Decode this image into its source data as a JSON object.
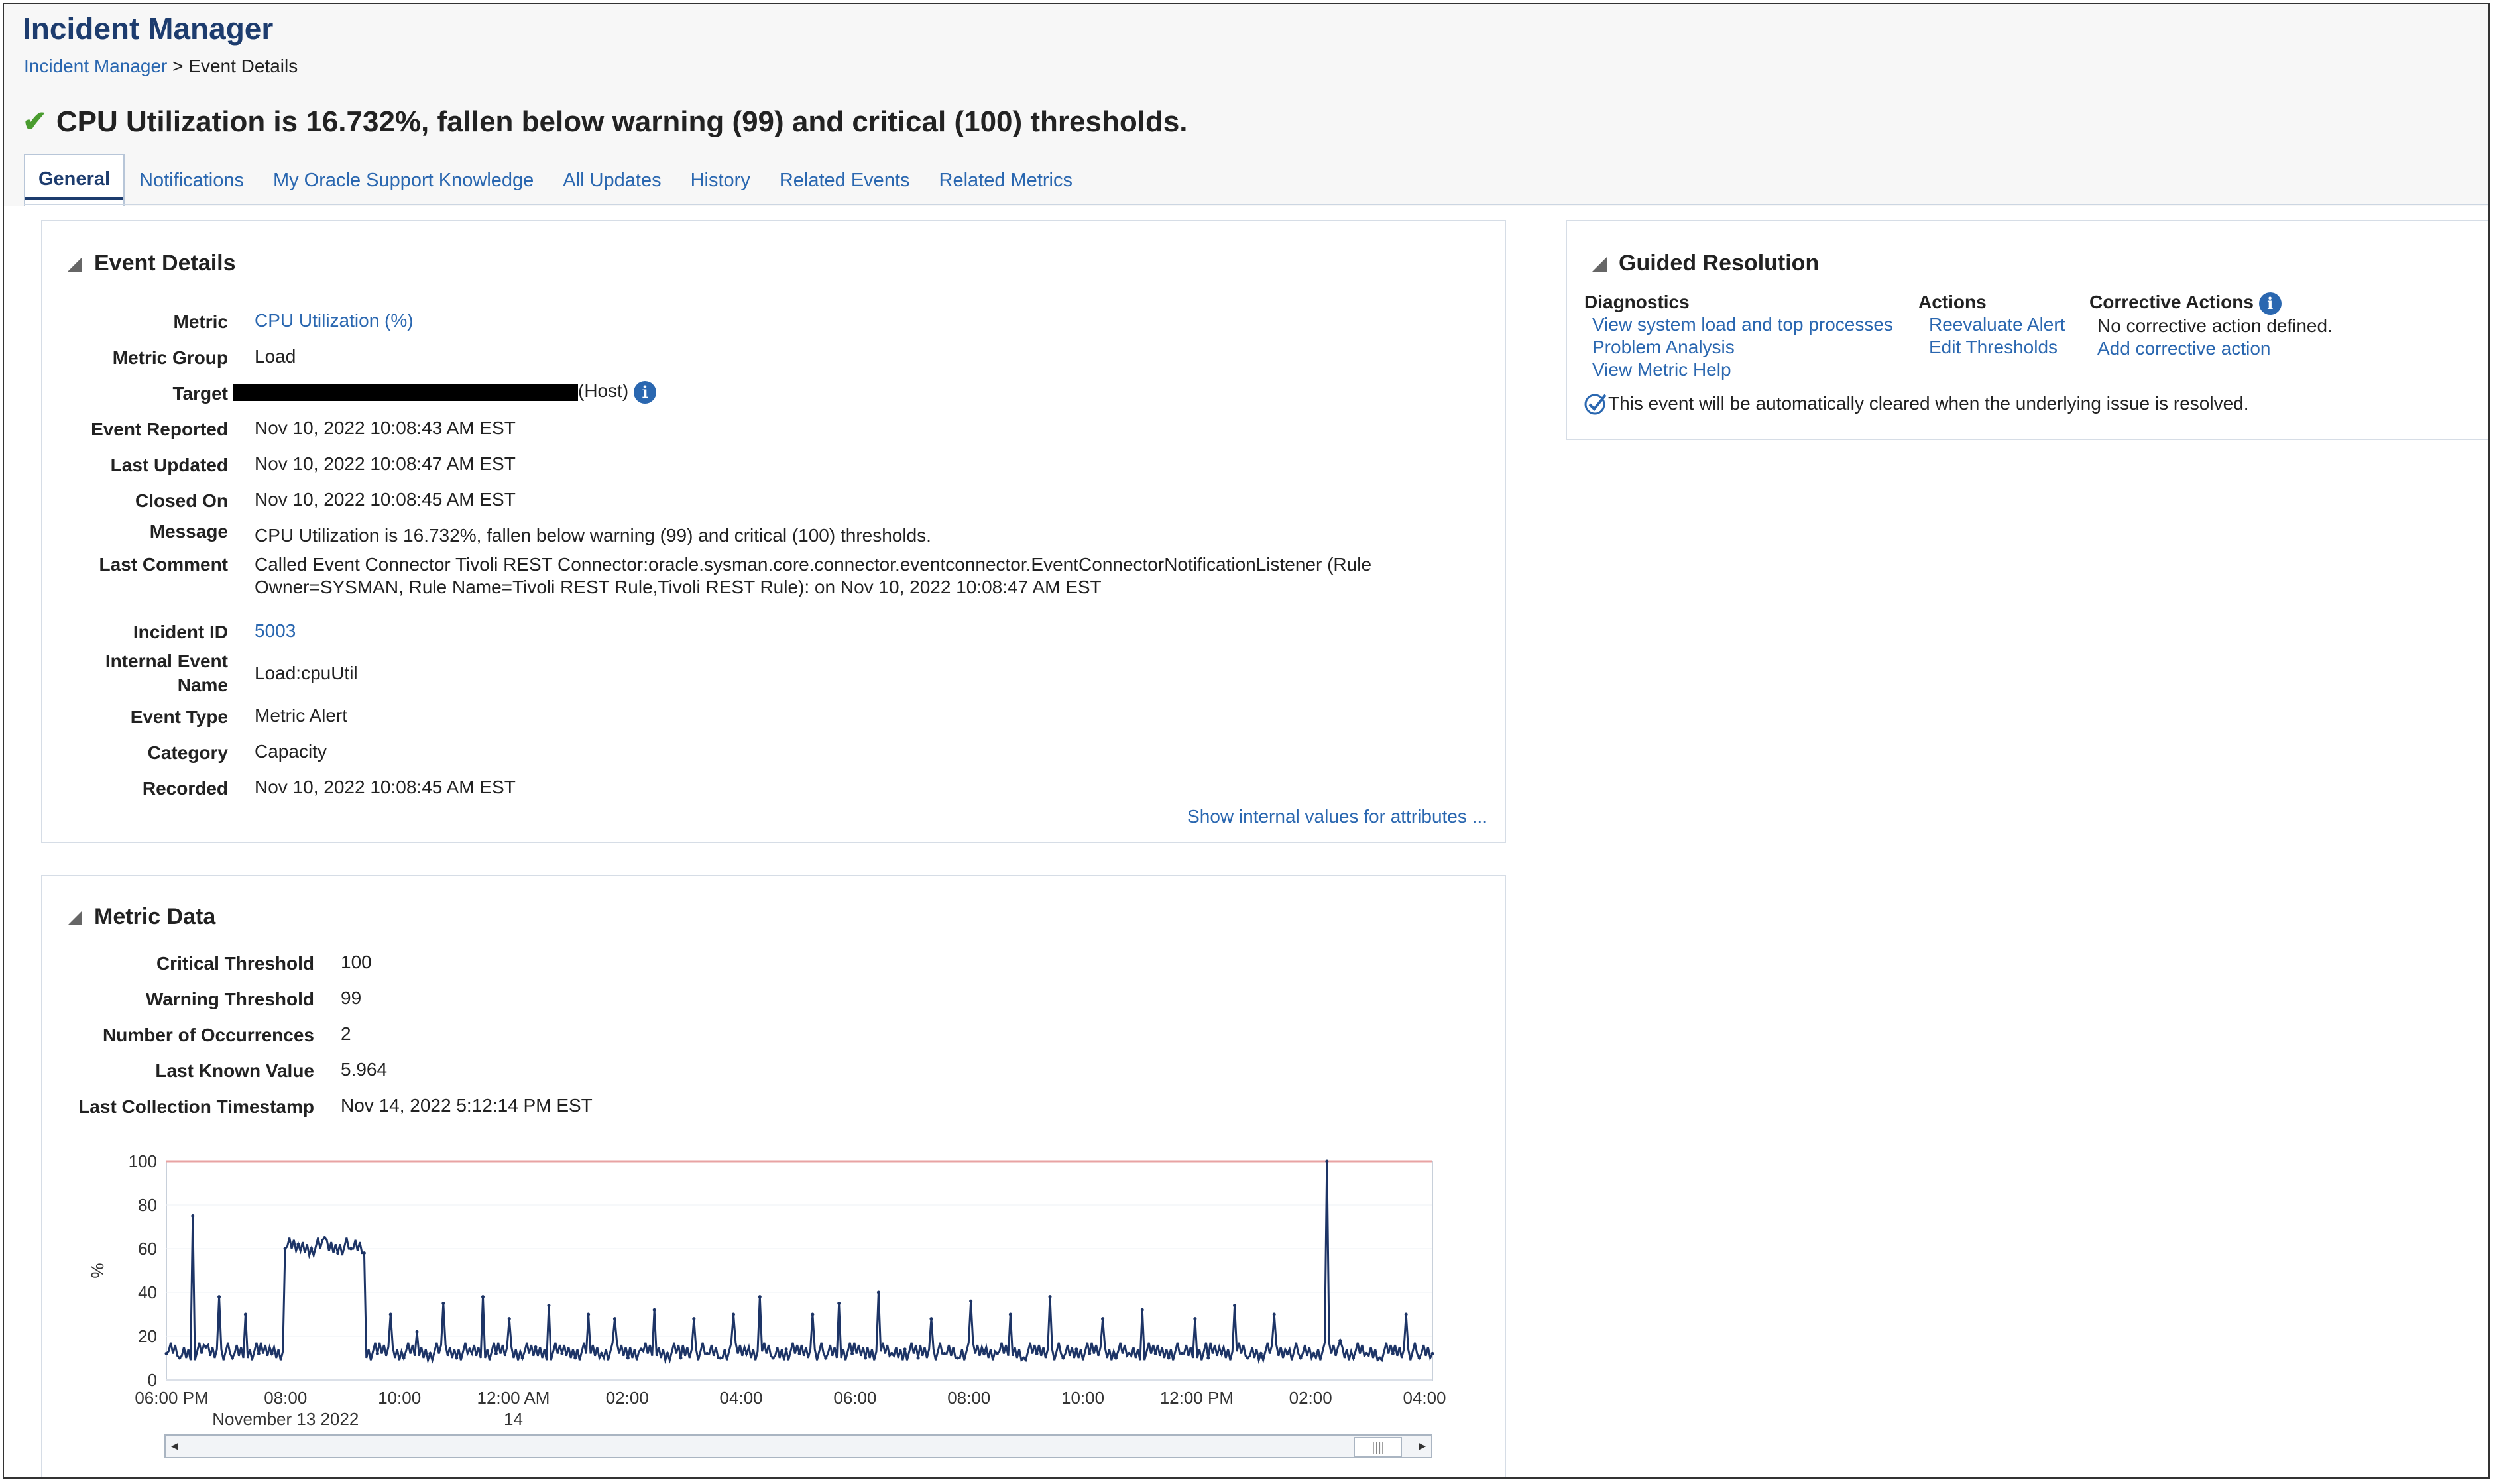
{
  "app": {
    "title": "Incident Manager"
  },
  "breadcrumb": {
    "link": "Incident Manager",
    "sep": ">",
    "current": "Event Details"
  },
  "status": {
    "text": "CPU Utilization is 16.732%, fallen below warning (99) and critical (100) thresholds.",
    "icon": "check-icon",
    "color": "#4a9c2f"
  },
  "tabs": [
    "General",
    "Notifications",
    "My Oracle Support Knowledge",
    "All Updates",
    "History",
    "Related Events",
    "Related Metrics"
  ],
  "event_details": {
    "title": "Event Details",
    "metric_label": "Metric",
    "metric_value": "CPU Utilization (%)",
    "group_label": "Metric Group",
    "group_value": "Load",
    "target_label": "Target",
    "target_suffix": "(Host)",
    "reported_label": "Event Reported",
    "reported_value": "Nov 10, 2022 10:08:43 AM EST",
    "updated_label": "Last Updated",
    "updated_value": "Nov 10, 2022 10:08:47 AM EST",
    "closed_label": "Closed On",
    "closed_value": "Nov 10, 2022 10:08:45 AM EST",
    "message_label": "Message",
    "message_value": "CPU Utilization is 16.732%, fallen below warning (99) and critical (100) thresholds.",
    "comment_label": "Last Comment",
    "comment_line1": "Called Event Connector Tivoli REST Connector:oracle.sysman.core.connector.eventconnector.EventConnectorNotificationListener (Rule",
    "comment_line2": "Owner=SYSMAN, Rule Name=Tivoli REST Rule,Tivoli REST Rule): on Nov 10, 2022 10:08:47 AM EST",
    "incident_label": "Incident ID",
    "incident_value": "5003",
    "internal_label1": "Internal Event",
    "internal_label2": "Name",
    "internal_value": "Load:cpuUtil",
    "type_label": "Event Type",
    "type_value": "Metric Alert",
    "category_label": "Category",
    "category_value": "Capacity",
    "recorded_label": "Recorded",
    "recorded_value": "Nov 10, 2022 10:08:45 AM EST",
    "show_internal": "Show internal values for attributes ..."
  },
  "guided": {
    "title": "Guided Resolution",
    "diag_header": "Diagnostics",
    "diag_items": [
      "View system load and top processes",
      "Problem Analysis",
      "View Metric Help"
    ],
    "actions_header": "Actions",
    "actions_items": [
      "Reevaluate Alert",
      "Edit Thresholds"
    ],
    "corrective_header": "Corrective Actions",
    "corrective_none": "No corrective action defined.",
    "corrective_add": "Add corrective action",
    "auto_clear": "This event will be automatically cleared when the underlying issue is resolved."
  },
  "metric_data": {
    "title": "Metric Data",
    "critical_label": "Critical Threshold",
    "critical_value": "100",
    "warning_label": "Warning Threshold",
    "warning_value": "99",
    "occ_label": "Number of Occurrences",
    "occ_value": "2",
    "last_label": "Last Known Value",
    "last_value": "5.964",
    "ts_label": "Last Collection Timestamp",
    "ts_value": "Nov 14, 2022 5:12:14 PM EST"
  },
  "chart_data": {
    "type": "line",
    "ylabel": "%",
    "ylim": [
      0,
      100
    ],
    "yticks": [
      0,
      20,
      40,
      60,
      80,
      100
    ],
    "xticks": [
      "06:00 PM",
      "08:00",
      "10:00",
      "12:00 AM",
      "02:00",
      "04:00",
      "06:00",
      "08:00",
      "10:00",
      "12:00 PM",
      "02:00",
      "04:00"
    ],
    "xtick_sub": {
      "1": "November 13 2022",
      "3": "14"
    },
    "threshold": 100,
    "series": [
      {
        "color": "#1d3466",
        "x_hours": [
          0,
          0.25,
          0.5,
          0.75,
          1,
          1.25,
          1.5,
          1.75,
          2,
          2.25,
          2.5,
          2.75,
          3,
          3.25,
          3.5,
          3.75,
          4,
          4.25,
          4.5,
          4.75,
          5,
          5.25,
          5.5,
          5.75,
          6,
          6.25,
          6.5,
          6.75,
          7,
          7.25,
          7.5,
          7.75,
          8,
          8.25,
          8.5,
          8.75,
          9,
          9.25,
          9.5,
          9.75,
          10,
          10.25,
          10.5,
          10.75,
          11,
          11.25,
          11.5,
          11.75,
          12,
          12.25,
          12.5,
          12.75,
          13,
          13.25,
          13.5,
          13.75,
          14,
          14.25,
          14.5,
          14.75,
          15,
          15.25,
          15.5,
          15.75,
          16,
          16.25,
          16.5,
          16.75,
          17,
          17.25,
          17.5,
          17.75,
          18,
          18.25,
          18.5,
          18.75,
          19,
          19.25,
          19.5,
          19.75,
          20,
          20.25,
          20.5,
          20.75,
          21,
          21.25,
          21.5,
          21.75,
          22,
          22.25,
          22.5,
          22.75,
          23,
          23.25,
          23.5,
          23.75,
          24
        ],
        "values": [
          12,
          10,
          75,
          15,
          38,
          10,
          30,
          12,
          12,
          60,
          62,
          60,
          65,
          58,
          60,
          58,
          12,
          30,
          10,
          22,
          12,
          35,
          10,
          14,
          38,
          12,
          28,
          10,
          15,
          34,
          12,
          10,
          30,
          12,
          28,
          10,
          14,
          32,
          12,
          10,
          28,
          12,
          10,
          30,
          12,
          38,
          10,
          14,
          12,
          30,
          10,
          35,
          12,
          10,
          40,
          12,
          14,
          10,
          28,
          12,
          10,
          36,
          12,
          12,
          30,
          10,
          12,
          38,
          10,
          14,
          12,
          28,
          10,
          12,
          32,
          12,
          10,
          12,
          28,
          10,
          12,
          34,
          10,
          12,
          30,
          12,
          10,
          12,
          100,
          18,
          10,
          12,
          10,
          12,
          30,
          10,
          12
        ]
      }
    ]
  }
}
